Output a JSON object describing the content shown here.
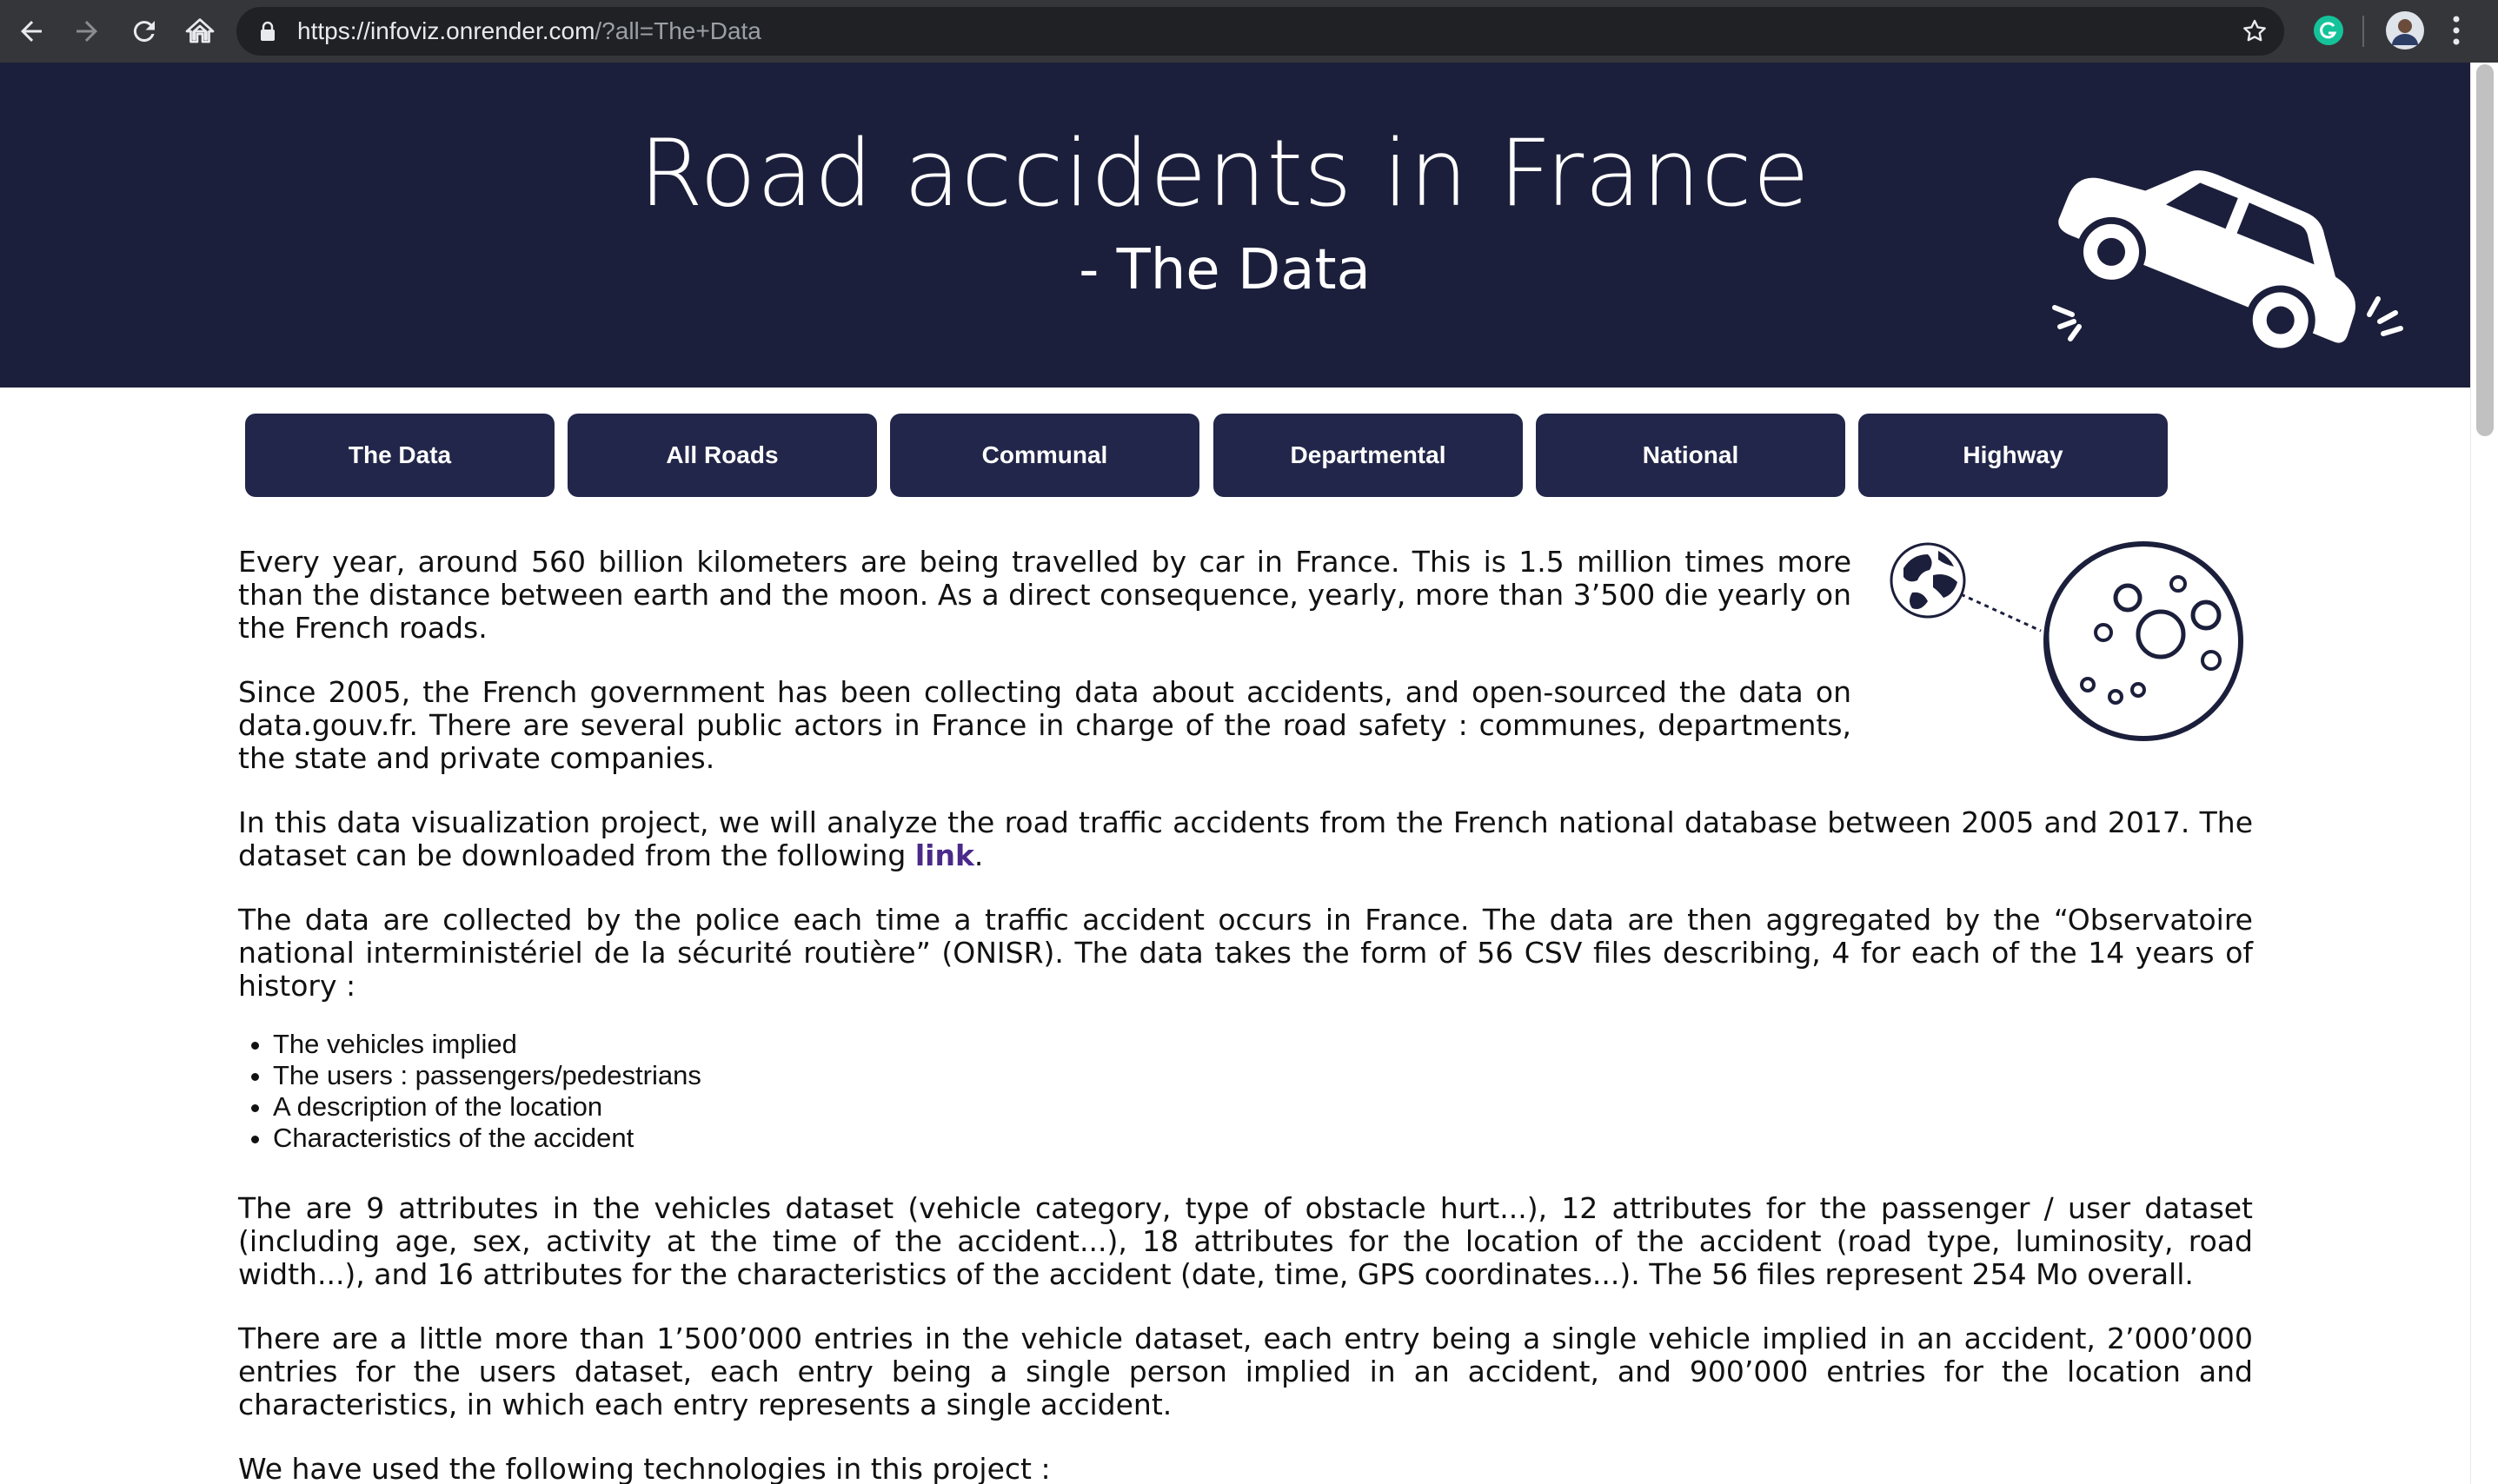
{
  "browser": {
    "url_host": "https://infoviz.onrender.com",
    "url_path": "/?all=The+Data",
    "icons": [
      "back-icon",
      "forward-icon",
      "reload-icon",
      "home-icon",
      "lock-icon",
      "bookmark-star-icon",
      "grammarly-extension-icon",
      "profile-avatar",
      "more-menu-icon"
    ]
  },
  "header": {
    "title": "Road accidents in France",
    "subtitle": "- The Data",
    "illustration": "tilted-car-icon",
    "background_color": "#1c1f3b"
  },
  "tabs": [
    {
      "label": "The Data"
    },
    {
      "label": "All Roads"
    },
    {
      "label": "Communal"
    },
    {
      "label": "Departmental"
    },
    {
      "label": "National"
    },
    {
      "label": "Highway"
    }
  ],
  "content": {
    "illustration": "earth-moon-icon",
    "p1": "Every year, around 560 billion kilometers are being travelled by car in France. This is 1.5 million times more than the distance between earth and the moon. As a direct consequence, yearly, more than 3’500 die yearly on the French roads.",
    "p2": "Since 2005, the French government has been collecting data about accidents, and open-sourced the data on data.gouv.fr. There are several public actors in France in charge of the road safety : communes, departments, the state and private companies.",
    "p3_before": "In this data visualization project, we will analyze the road traffic accidents from the French national database between 2005 and 2017. The dataset can be downloaded from the following ",
    "p3_link": "link",
    "p3_after": ".",
    "p4": "The data are collected by the police each time a traffic accident occurs in France. The data are then aggregated by the “Observatoire national interministériel de la sécurité routière” (ONISR). The data takes the form of 56 CSV files describing, 4 for each of the 14 years of history :",
    "list": [
      "The vehicles implied",
      "The users : passengers/pedestrians",
      "A description of the location",
      "Characteristics of the accident"
    ],
    "p5": "The are 9 attributes in the vehicles dataset (vehicle category, type of obstacle hurt...), 12 attributes for the passenger / user dataset (including age, sex, activity at the time of the accident...), 18 attributes for the location of the accident (road type, luminosity, road width...), and 16 attributes for the characteristics of the accident (date, time, GPS coordinates...). The 56 files represent 254 Mo overall.",
    "p6": "There are a little more than 1’500’000 entries in the vehicle dataset, each entry being a single vehicle implied in an accident, 2’000’000 entries for the users dataset, each entry being a single person implied in an accident, and 900’000 entries for the location and characteristics, in which each entry represents a single accident.",
    "p7": "We have used the following technologies in this project :"
  }
}
